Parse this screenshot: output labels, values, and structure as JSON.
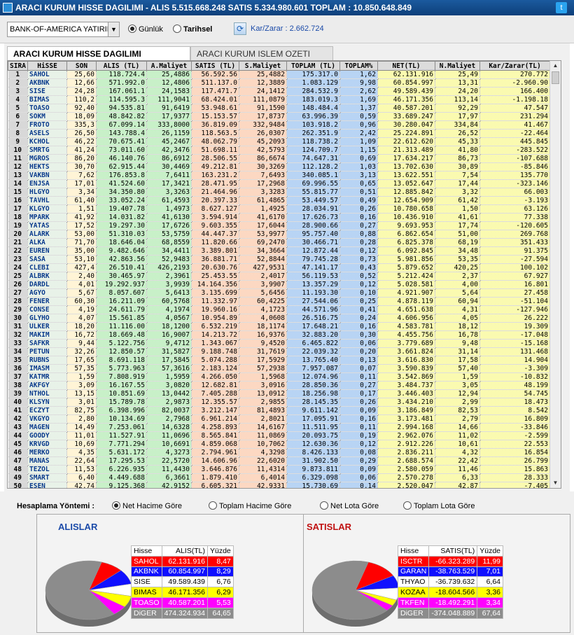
{
  "window": {
    "title": "ARACI KURUM HISSE DAGILIMI - ALIS 5.515.668.248  SATIS 5.334.980.601  TOPLAM : 10.850.648.849"
  },
  "toolbar": {
    "broker": "BANK-OF-AMERICA YATIRIM",
    "radio_daily": "Günlük",
    "radio_historical": "Tarihsel",
    "karzarar": "Kar/Zarar : 2.662.724"
  },
  "tabs": [
    "ARACI KURUM HISSE DAGILIMI",
    "ARACI KURUM ISLEM OZETI"
  ],
  "columns": [
    "SIRA",
    "HiSSE",
    "SON",
    "ALIS (TL)",
    "A.Maliyet",
    "SATIS (TL)",
    "S.Maliyet",
    "TOPLAM (TL)",
    "TOPLAM%",
    "NET(TL)",
    "N.Maliyet",
    "Kar/Zarar(TL)"
  ],
  "rows": [
    [
      "1",
      "SAHOL",
      "25,60",
      "118.724.4",
      "25,4886",
      "56.592.56",
      "25,4882",
      "175.317.0",
      "1,62",
      "62.131.916",
      "25,49",
      "270.772"
    ],
    [
      "2",
      "AKBNK",
      "12,66",
      "571.992.0",
      "12,4806",
      "511.137.0",
      "12,3889",
      "1.083.129",
      "9,98",
      "60.854.997",
      "13,31",
      "-2.960.90"
    ],
    [
      "3",
      "SISE",
      "24,28",
      "167.061.1",
      "24,1583",
      "117.471.7",
      "24,1412",
      "284.532.9",
      "2,62",
      "49.589.439",
      "24,20",
      "166.400"
    ],
    [
      "4",
      "BIMAS",
      "110,2",
      "114.595.3",
      "111,9041",
      "68.424.01",
      "111,0879",
      "183.019.3",
      "1,69",
      "46.171.356",
      "113,14",
      "-1.198.18"
    ],
    [
      "5",
      "TOASO",
      "92,40",
      "94.535.81",
      "91,6419",
      "53.948.61",
      "91,1590",
      "148.484.4",
      "1,37",
      "40.587.201",
      "92,29",
      "47.547"
    ],
    [
      "6",
      "SOKM",
      "18,09",
      "48.842.82",
      "17,9377",
      "15.153.57",
      "17,8737",
      "63.996.39",
      "0,59",
      "33.689.247",
      "17,97",
      "231.294"
    ],
    [
      "7",
      "FROTO",
      "335,3",
      "67.099.14",
      "333,8000",
      "36.819.09",
      "332,9484",
      "103.918.2",
      "0,96",
      "30.280.047",
      "334,84",
      "41.467"
    ],
    [
      "8",
      "ASELS",
      "26,50",
      "143.788.4",
      "26,1159",
      "118.563.5",
      "26,0307",
      "262.351.9",
      "2,42",
      "25.224.891",
      "26,52",
      "-22.464"
    ],
    [
      "9",
      "KCHOL",
      "46,22",
      "70.675.41",
      "45,2467",
      "48.062.79",
      "45,2093",
      "118.738.2",
      "1,09",
      "22.612.620",
      "45,33",
      "445.845"
    ],
    [
      "10",
      "SMRTG",
      "41,24",
      "73.011.60",
      "42,3476",
      "51.698.11",
      "42,5793",
      "124.709.7",
      "1,15",
      "21.313.489",
      "41,80",
      "-283.522"
    ],
    [
      "11",
      "MGROS",
      "86,20",
      "46.140.76",
      "86,6912",
      "28.506.55",
      "86,6674",
      "74.647.31",
      "0,69",
      "17.634.217",
      "86,73",
      "-107.688"
    ],
    [
      "12",
      "HEKTS",
      "30,70",
      "62.915.44",
      "30,4469",
      "49.212.81",
      "30,3269",
      "112.128.2",
      "1,03",
      "13.702.630",
      "30,89",
      "-85.846"
    ],
    [
      "13",
      "VAKBN",
      "7,62",
      "176.853.8",
      "7,6411",
      "163.231.2",
      "7,6493",
      "340.085.1",
      "3,13",
      "13.622.551",
      "7,54",
      "135.770"
    ],
    [
      "14",
      "ENJSA",
      "17,01",
      "41.524.60",
      "17,3421",
      "28.471.95",
      "17,2968",
      "69.996.55",
      "0,65",
      "13.052.647",
      "17,44",
      "-323.146"
    ],
    [
      "15",
      "HLGYO",
      "3,34",
      "34.350.80",
      "3,3263",
      "21.464.96",
      "3,3283",
      "55.815.77",
      "0,51",
      "12.885.842",
      "3,32",
      "66.003"
    ],
    [
      "16",
      "TAVHL",
      "61,40",
      "33.052.24",
      "61,4593",
      "20.397.33",
      "61,4865",
      "53.449.57",
      "0,49",
      "12.654.909",
      "61,42",
      "-3.193"
    ],
    [
      "17",
      "KLGYO",
      "1,51",
      "19.407.78",
      "1,4973",
      "8.627.127",
      "1,4925",
      "28.034.91",
      "0,26",
      "10.780.658",
      "1,50",
      "63.126"
    ],
    [
      "18",
      "MPARK",
      "41,92",
      "14.031.82",
      "41,6130",
      "3.594.914",
      "41,6170",
      "17.626.73",
      "0,16",
      "10.436.910",
      "41,61",
      "77.338"
    ],
    [
      "19",
      "YATAS",
      "17,52",
      "19.297.30",
      "17,6726",
      "9.603.355",
      "17,6044",
      "28.900.66",
      "0,27",
      "9.693.953",
      "17,74",
      "-120.605"
    ],
    [
      "20",
      "ALARK",
      "53,00",
      "51.310.03",
      "53,5759",
      "44.447.37",
      "53,9977",
      "95.757.40",
      "0,88",
      "6.862.654",
      "51,00",
      "269.768"
    ],
    [
      "21",
      "ALKA",
      "71,70",
      "18.646.04",
      "68,8559",
      "11.820.66",
      "69,2470",
      "30.466.71",
      "0,28",
      "6.825.378",
      "68,19",
      "351.433"
    ],
    [
      "22",
      "EUREN",
      "35,00",
      "9.482.646",
      "34,4411",
      "3.389.801",
      "34,3664",
      "12.872.44",
      "0,12",
      "6.092.845",
      "34,48",
      "91.375"
    ],
    [
      "23",
      "SASA",
      "53,10",
      "42.863.56",
      "52,9483",
      "36.881.71",
      "52,8844",
      "79.745.28",
      "0,73",
      "5.981.856",
      "53,35",
      "-27.594"
    ],
    [
      "24",
      "CLEBI",
      "427,4",
      "26.510.41",
      "426,2193",
      "20.630.76",
      "427,9531",
      "47.141.17",
      "0,43",
      "5.879.652",
      "420,25",
      "100.102"
    ],
    [
      "25",
      "ALBRK",
      "2,40",
      "30.465.97",
      "2,3961",
      "25.453.55",
      "2,4017",
      "56.119.53",
      "0,52",
      "5.212.424",
      "2,37",
      "67.927"
    ],
    [
      "26",
      "DARDL",
      "4,01",
      "19.292.937",
      "3,9939",
      "14.164.356",
      "3,9907",
      "13.357.29",
      "0,12",
      "5.028.581",
      "4,00",
      "16.801"
    ],
    [
      "27",
      "AGYO",
      "5,67",
      "8.057.607",
      "5,6413",
      "3.135.699",
      "5,6456",
      "11.193.30",
      "0,10",
      "4.921.907",
      "5,64",
      "27.458"
    ],
    [
      "28",
      "FENER",
      "60,30",
      "16.211.09",
      "60,5768",
      "11.332.97",
      "60,4225",
      "27.544.06",
      "0,25",
      "4.878.119",
      "60,94",
      "-51.104"
    ],
    [
      "29",
      "CONSE",
      "4,19",
      "24.611.79",
      "4,1974",
      "19.960.16",
      "4,1723",
      "44.571.96",
      "0,41",
      "4.651.638",
      "4,31",
      "-127.946"
    ],
    [
      "30",
      "GLYHO",
      "4,07",
      "15.561.85",
      "4,0567",
      "10.954.89",
      "4,0608",
      "26.516.75",
      "0,24",
      "4.606.956",
      "4,05",
      "26.222"
    ],
    [
      "31",
      "ULKER",
      "18,20",
      "11.116.00",
      "18,1200",
      "6.532.219",
      "18,1174",
      "17.648.21",
      "0,16",
      "4.583.781",
      "18,12",
      "19.309"
    ],
    [
      "32",
      "MAKIM",
      "16,72",
      "18.669.48",
      "16,9007",
      "14.213.72",
      "16,9376",
      "32.883.20",
      "0,30",
      "4.455.756",
      "16,78",
      "-17.048"
    ],
    [
      "33",
      "SAFKR",
      "9,44",
      "5.122.756",
      "9,4712",
      "1.343.067",
      "9,4520",
      "6.465.822",
      "0,06",
      "3.779.689",
      "9,48",
      "-15.168"
    ],
    [
      "34",
      "PETUN",
      "32,26",
      "12.850.57",
      "31,5827",
      "9.188.748",
      "31,7619",
      "22.039.32",
      "0,20",
      "3.661.824",
      "31,14",
      "131.468"
    ],
    [
      "35",
      "RUBNS",
      "17,65",
      "8.691.118",
      "17,5845",
      "5.074.288",
      "17,5929",
      "13.765.40",
      "0,13",
      "3.616.830",
      "17,58",
      "14.904"
    ],
    [
      "36",
      "IMASM",
      "57,35",
      "5.773.963",
      "57,3616",
      "2.183.124",
      "57,2938",
      "7.957.087",
      "0,07",
      "3.590.839",
      "57,40",
      "-3.309"
    ],
    [
      "37",
      "KATMR",
      "1,59",
      "7.808.919",
      "1,5959",
      "4.266.050",
      "1,5968",
      "12.074.96",
      "0,11",
      "3.542.869",
      "1,59",
      "-10.832"
    ],
    [
      "38",
      "AKFGY",
      "3,09",
      "16.167.55",
      "3,0820",
      "12.682.81",
      "3,0916",
      "28.850.36",
      "0,27",
      "3.484.737",
      "3,05",
      "48.199"
    ],
    [
      "39",
      "NTHOL",
      "13,15",
      "10.851.69",
      "13,0442",
      "7.405.288",
      "13,0912",
      "18.256.98",
      "0,17",
      "3.446.403",
      "12,94",
      "54.745"
    ],
    [
      "40",
      "KLSYN",
      "3,01",
      "15.789.78",
      "2,9873",
      "12.355.57",
      "2,9855",
      "28.145.35",
      "0,26",
      "3.434.210",
      "2,99",
      "18.473"
    ],
    [
      "41",
      "ECZYT",
      "82,75",
      "6.398.996",
      "82,0037",
      "3.212.147",
      "81,4893",
      "9.611.142",
      "0,09",
      "3.186.849",
      "82,53",
      "8.542"
    ],
    [
      "42",
      "VKGYO",
      "2,80",
      "10.134.69",
      "2,7968",
      "6.961.214",
      "2,8021",
      "17.095.91",
      "0,16",
      "3.173.481",
      "2,79",
      "16.809"
    ],
    [
      "43",
      "MAGEN",
      "14,49",
      "7.253.061",
      "14,6328",
      "4.258.893",
      "14,6167",
      "11.511.95",
      "0,11",
      "2.994.168",
      "14,66",
      "-33.846"
    ],
    [
      "44",
      "GOODY",
      "11,01",
      "11.527.91",
      "11,0696",
      "8.565.841",
      "11,0869",
      "20.093.75",
      "0,19",
      "2.962.076",
      "11,02",
      "-2.599"
    ],
    [
      "45",
      "KRVGD",
      "10,69",
      "7.771.294",
      "10,6691",
      "4.859.068",
      "10,7062",
      "12.630.36",
      "0,12",
      "2.912.226",
      "10,61",
      "22.553"
    ],
    [
      "46",
      "MERKO",
      "4,35",
      "5.631.172",
      "4,3273",
      "2.794.961",
      "4,3298",
      "8.426.133",
      "0,08",
      "2.836.211",
      "4,32",
      "16.854"
    ],
    [
      "47",
      "MANAS",
      "22,64",
      "17.295.53",
      "22,5720",
      "14.606.96",
      "22,6020",
      "31.902.50",
      "0,29",
      "2.688.574",
      "22,42",
      "26.799"
    ],
    [
      "48",
      "TEZOL",
      "11,53",
      "6.226.935",
      "11,4430",
      "3.646.876",
      "11,4314",
      "9.873.811",
      "0,09",
      "2.580.059",
      "11,46",
      "15.863"
    ],
    [
      "49",
      "SMART",
      "6,40",
      "4.449.688",
      "6,3661",
      "1.879.410",
      "6,4014",
      "6.329.098",
      "0,06",
      "2.570.278",
      "6,33",
      "28.333"
    ],
    [
      "50",
      "ESEN",
      "42,74",
      "9.125.368",
      "42,9152",
      "6.605.321",
      "42,9331",
      "15.730.69",
      "0,14",
      "2.520.047",
      "42,87",
      "-7.405"
    ]
  ],
  "calc": {
    "label": "Hesaplama Yöntemi :",
    "options": [
      "Net Hacime Göre",
      "Toplam Hacime Göre",
      "Net Lota Göre",
      "Toplam Lota Göre"
    ]
  },
  "alislar": {
    "title": "ALISLAR",
    "headers": [
      "Hisse",
      "ALIS(TL)",
      "Yüzde"
    ],
    "rows": [
      [
        "SAHOL",
        "62.131.916",
        "8,47"
      ],
      [
        "AKBNK",
        "60.854.997",
        "8,29"
      ],
      [
        "SISE",
        "49.589.439",
        "6,76"
      ],
      [
        "BIMAS",
        "46.171.356",
        "6,29"
      ],
      [
        "TOASO",
        "40.587.201",
        "5,53"
      ],
      [
        "DiGER",
        "474.324.934",
        "64,65"
      ]
    ],
    "colors": [
      "#ff0000",
      "#1010ff",
      "#ffffff",
      "#ffff00",
      "#ff00ff",
      "#8c8c8c"
    ]
  },
  "satislar": {
    "title": "SATISLAR",
    "headers": [
      "Hisse",
      "SATIS(TL)",
      "Yüzde"
    ],
    "rows": [
      [
        "ISCTR",
        "-66.323.289",
        "11,99"
      ],
      [
        "GARAN",
        "-38.763.529",
        "7,01"
      ],
      [
        "THYAO",
        "-36.739.632",
        "6,64"
      ],
      [
        "KOZAA",
        "-18.604.566",
        "3,36"
      ],
      [
        "TKFEN",
        "-18.492.291",
        "3,34"
      ],
      [
        "DiGER",
        "-374.048.889",
        "67,64"
      ]
    ],
    "colors": [
      "#ff0000",
      "#1010ff",
      "#ffffff",
      "#ffff00",
      "#ff00ff",
      "#8c8c8c"
    ]
  },
  "colors": {
    "title_bg": "#0d3f7a",
    "accent_red": "#c01010",
    "accent_blue": "#1a4aa8"
  }
}
